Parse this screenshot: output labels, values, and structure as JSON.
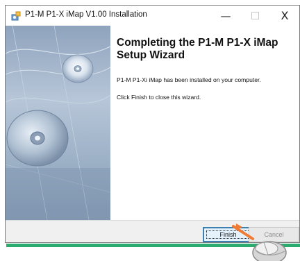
{
  "window": {
    "title": "P1-M P1-X iMap V1.00 Installation",
    "icon": "installer-icon",
    "controls": {
      "minimize": "—",
      "maximize": "",
      "close": "X"
    }
  },
  "wizard": {
    "heading": "Completing the P1-M P1-X iMap Setup Wizard",
    "message_installed": "P1-M P1-Xi iMap has been installed on your computer.",
    "message_finish": "Click Finish to close this wizard.",
    "side_image": "cd-disc-graphic"
  },
  "buttons": {
    "finish": "Finish",
    "cancel": "Cancel"
  },
  "colors": {
    "accent_green": "#2bab6d",
    "focus_blue": "#3c7fb1",
    "pointer_orange": "#f07a33"
  },
  "annotation": {
    "pointer": "orange-arrow-icon",
    "mouse": "mouse-icon"
  }
}
